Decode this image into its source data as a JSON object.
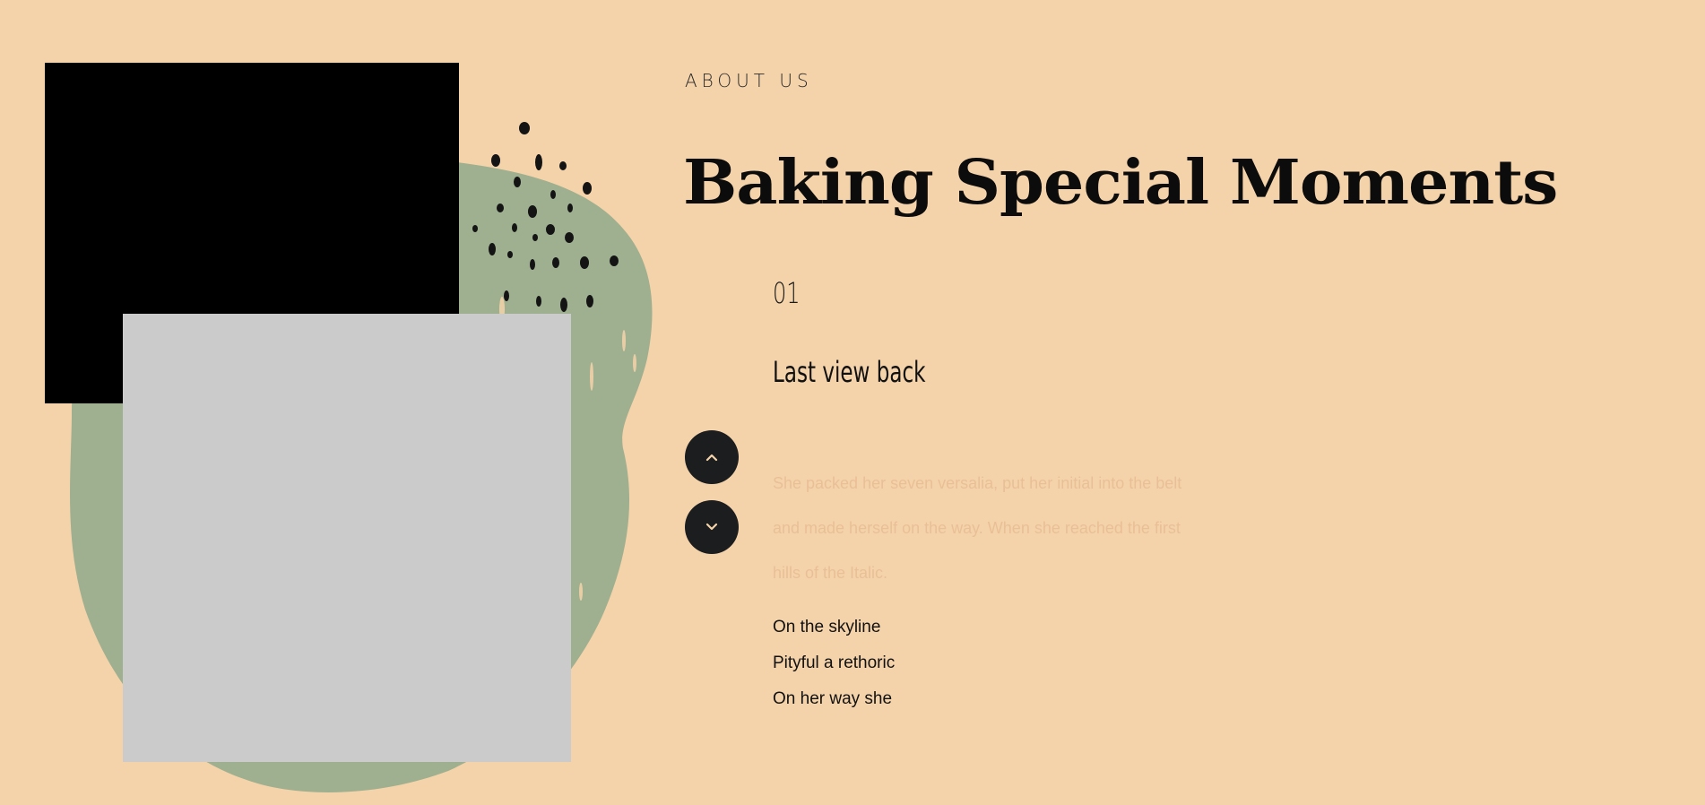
{
  "section": {
    "eyebrow": "ABOUT US",
    "headline": "Baking Special Moments"
  },
  "slide": {
    "number": "01",
    "title": "Last view back",
    "description": "She packed her seven versalia, put her initial into the belt and made herself on the way. When she reached the first hills of the Italic."
  },
  "nav": {
    "prev_icon": "chevron-up-icon",
    "next_icon": "chevron-down-icon"
  },
  "list": [
    "On the skyline",
    "Pityful a rethoric",
    "On her way she"
  ],
  "colors": {
    "background": "#f5d3aa",
    "blob": "#9fb090",
    "button": "#1b1d1e",
    "description_text": "#e9bf97"
  }
}
